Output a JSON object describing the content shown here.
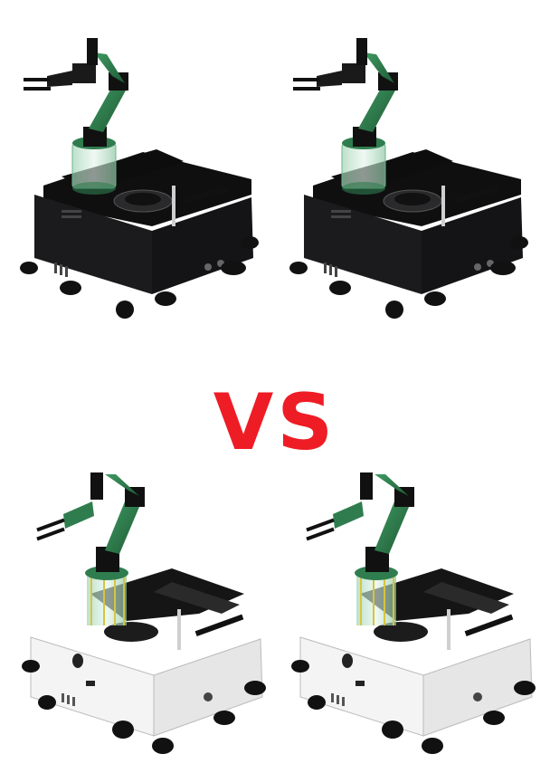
{
  "comparison": {
    "vs_label": "VS",
    "vs_color": "#ee1c25"
  },
  "robots": [
    {
      "variant": "black",
      "body_color": "#1b1b1d",
      "accent": "#2f7d4e"
    },
    {
      "variant": "black",
      "body_color": "#1b1b1d",
      "accent": "#2f7d4e"
    },
    {
      "variant": "white",
      "body_color": "#f2f2f2",
      "accent": "#2f7d4e"
    },
    {
      "variant": "white",
      "body_color": "#f2f2f2",
      "accent": "#2f7d4e"
    }
  ]
}
